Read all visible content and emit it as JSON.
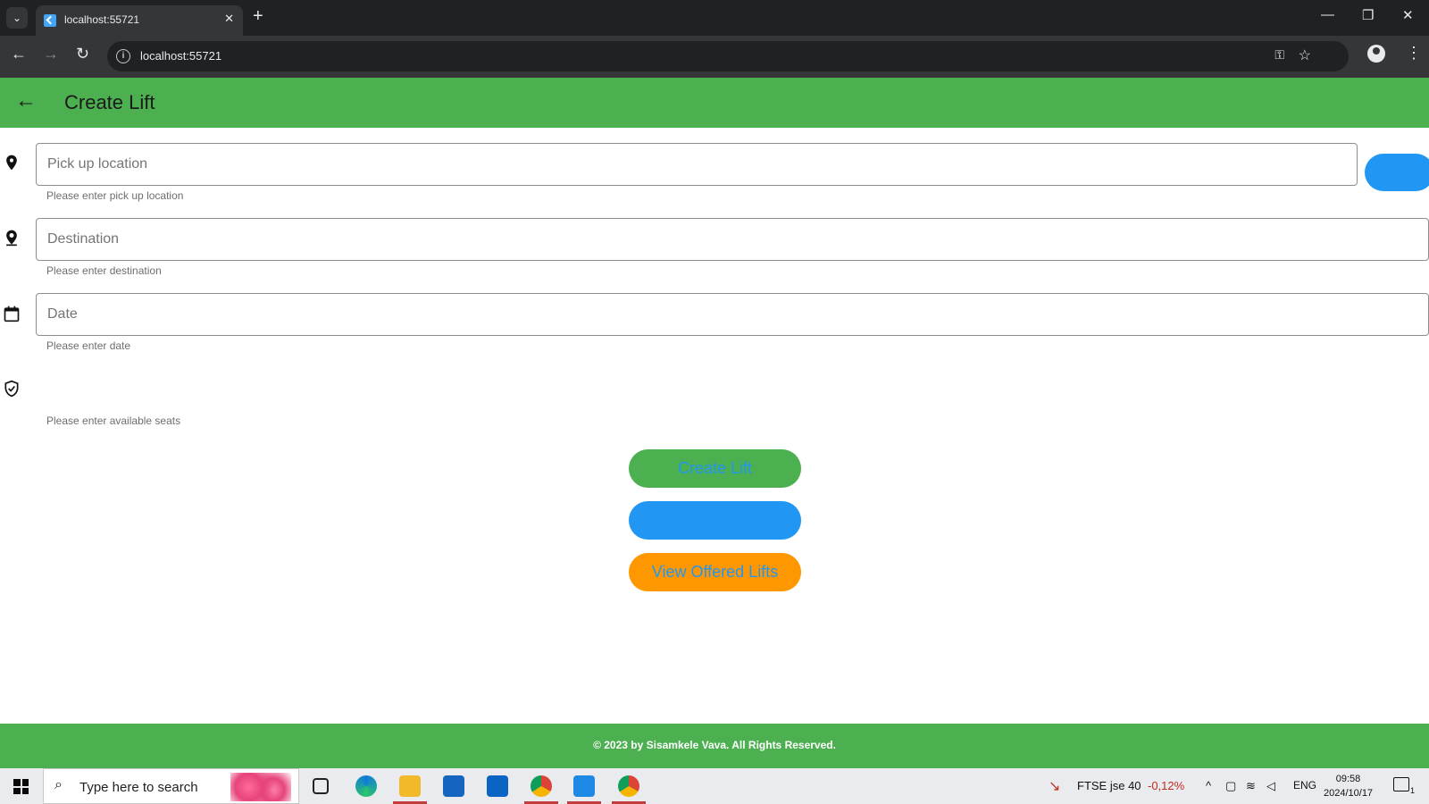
{
  "browser": {
    "tab_title": "localhost:55721",
    "url": "localhost:55721",
    "new_tab_symbol": "+",
    "close_tab_symbol": "✕"
  },
  "app": {
    "title": "Create Lift",
    "brand_color": "#4caf50",
    "fields": [
      {
        "placeholder": "Pick up location",
        "helper": "Please enter pick up location",
        "icon": "location-pin-icon"
      },
      {
        "placeholder": "Destination",
        "helper": "Please enter destination",
        "icon": "location-pin-icon"
      },
      {
        "placeholder": "Date",
        "helper": "Please enter date",
        "icon": "calendar-icon"
      },
      {
        "placeholder": "",
        "helper": "Please enter available seats",
        "icon": "shield-check-icon"
      }
    ],
    "buttons": {
      "create_lift": "Create Lift",
      "blank": "",
      "view_offered": "View Offered Lifts"
    },
    "footer": "© 2023 by Sisamkele Vava. All Rights Reserved."
  },
  "taskbar": {
    "search_placeholder": "Type here to search",
    "ftse_label": "FTSE jse 40",
    "ftse_change": "-0,12%",
    "language": "ENG",
    "time": "09:58",
    "date": "2024/10/17",
    "notification_count": "1"
  }
}
